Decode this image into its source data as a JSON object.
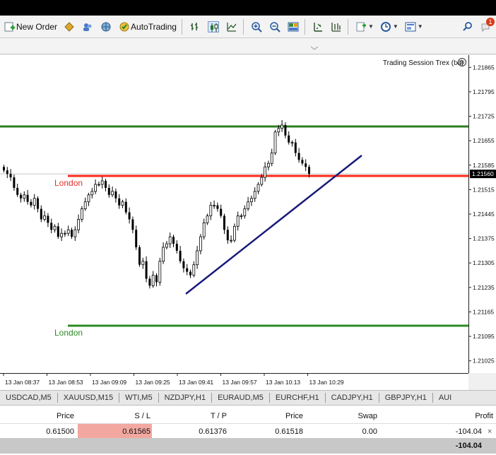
{
  "toolbar": {
    "new_order_label": "New Order",
    "autotrading_label": "AutoTrading",
    "notification_count": "1"
  },
  "chart": {
    "indicator_name": "Trading Session Trex (txt)",
    "indicator_close_glyph": "⊗",
    "current_price": "1.21560",
    "session_labels": {
      "upper": "London",
      "lower": "London"
    },
    "colors": {
      "upper_green": "#2e7d1f",
      "session_red": "#ff2a1a",
      "trend_navy": "#1a1a7a",
      "lower_green": "#2e8b22",
      "session_label_red": "#e0302a",
      "session_label_green": "#2e8b22",
      "candle": "#000000"
    },
    "price_ticks": [
      "1.21865",
      "1.21795",
      "1.21725",
      "1.21655",
      "1.21585",
      "1.21515",
      "1.21445",
      "1.21375",
      "1.21305",
      "1.21235",
      "1.21165",
      "1.21095",
      "1.21025"
    ],
    "time_ticks": [
      "13 Jan 08:37",
      "13 Jan 08:53",
      "13 Jan 09:09",
      "13 Jan 09:25",
      "13 Jan 09:41",
      "13 Jan 09:57",
      "13 Jan 10:13",
      "13 Jan 10:29"
    ]
  },
  "chart_data": {
    "type": "candlestick",
    "y_range": [
      1.2099,
      1.219
    ],
    "series_close": [
      1.2157,
      1.2156,
      1.2155,
      1.2152,
      1.215,
      1.2149,
      1.215,
      1.2148,
      1.2147,
      1.2149,
      1.2146,
      1.2143,
      1.2144,
      1.2142,
      1.214,
      1.2141,
      1.2138,
      1.2139,
      1.2139,
      1.214,
      1.2138,
      1.214,
      1.2143,
      1.2146,
      1.2148,
      1.215,
      1.2151,
      1.2153,
      1.2153,
      1.2154,
      1.2152,
      1.215,
      1.2151,
      1.2149,
      1.2147,
      1.2148,
      1.2145,
      1.2143,
      1.214,
      1.2135,
      1.213,
      1.2131,
      1.2126,
      1.2124,
      1.2127,
      1.2125,
      1.2131,
      1.2135,
      1.2136,
      1.2138,
      1.2136,
      1.2134,
      1.2131,
      1.2129,
      1.2128,
      1.2127,
      1.213,
      1.2134,
      1.2138,
      1.2142,
      1.2144,
      1.2147,
      1.2147,
      1.2146,
      1.2144,
      1.214,
      1.2137,
      1.2137,
      1.2141,
      1.2144,
      1.2144,
      1.2146,
      1.2148,
      1.2149,
      1.2151,
      1.2153,
      1.2155,
      1.2158,
      1.2159,
      1.2162,
      1.2168,
      1.2169,
      1.217,
      1.2167,
      1.2165,
      1.2165,
      1.2162,
      1.216,
      1.2159,
      1.2158,
      1.2156
    ]
  },
  "symbol_tabs": [
    "USDCAD,M5",
    "XAUUSD,M15",
    "WTI,M5",
    "NZDJPY,H1",
    "EURAUD,M5",
    "EURCHF,H1",
    "CADJPY,H1",
    "GBPJPY,H1",
    "AUI"
  ],
  "trade_table": {
    "headers": {
      "price": "Price",
      "sl": "S / L",
      "tp": "T / P",
      "price2": "Price",
      "swap": "Swap",
      "profit": "Profit"
    },
    "row": {
      "price": "0.61500",
      "sl": "0.61565",
      "tp": "0.61376",
      "price2": "0.61518",
      "swap": "0.00",
      "profit": "-104.04",
      "close_glyph": "×"
    },
    "total_profit": "-104.04"
  }
}
